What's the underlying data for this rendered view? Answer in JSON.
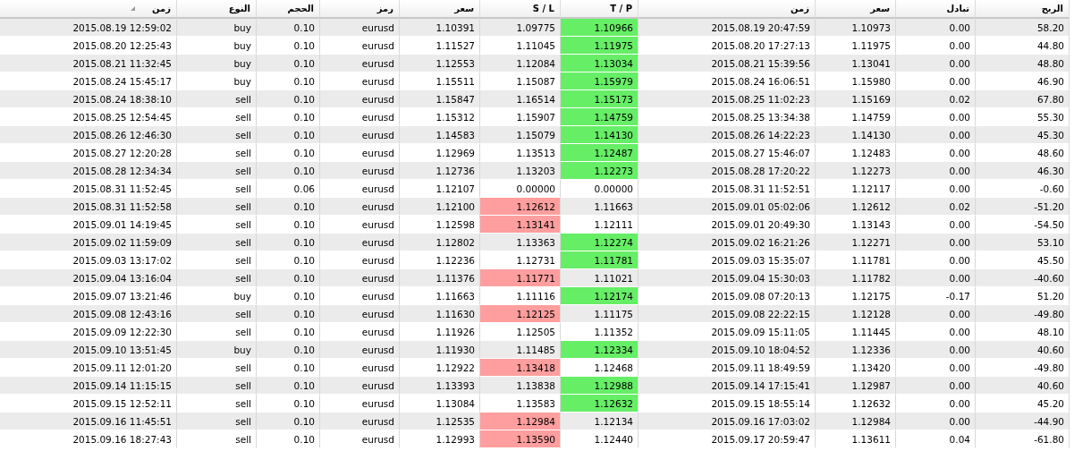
{
  "table": {
    "columns": [
      {
        "label": "زمن",
        "sorted": true
      },
      {
        "label": "النوع",
        "sorted": false
      },
      {
        "label": "الحجم",
        "sorted": false
      },
      {
        "label": "رمز",
        "sorted": false
      },
      {
        "label": "سعر",
        "sorted": false
      },
      {
        "label": "S / L",
        "sorted": false
      },
      {
        "label": "T / P",
        "sorted": false
      },
      {
        "label": "زمن",
        "sorted": false
      },
      {
        "label": "سعر",
        "sorted": false
      },
      {
        "label": "تبادل",
        "sorted": false
      },
      {
        "label": "الربح",
        "sorted": false
      }
    ],
    "rows": [
      {
        "cells": [
          "2015.08.19 12:59:02",
          "buy",
          "0.10",
          "eurusd",
          "1.10391",
          "1.09775",
          "1.10966",
          "2015.08.19 20:47:59",
          "1.10973",
          "0.00",
          "58.20"
        ],
        "sl_hit": false,
        "tp_hit": true
      },
      {
        "cells": [
          "2015.08.20 12:25:43",
          "buy",
          "0.10",
          "eurusd",
          "1.11527",
          "1.11045",
          "1.11975",
          "2015.08.20 17:27:13",
          "1.11975",
          "0.00",
          "44.80"
        ],
        "sl_hit": false,
        "tp_hit": true
      },
      {
        "cells": [
          "2015.08.21 11:32:45",
          "buy",
          "0.10",
          "eurusd",
          "1.12553",
          "1.12084",
          "1.13034",
          "2015.08.21 15:39:56",
          "1.13041",
          "0.00",
          "48.80"
        ],
        "sl_hit": false,
        "tp_hit": true
      },
      {
        "cells": [
          "2015.08.24 15:45:17",
          "buy",
          "0.10",
          "eurusd",
          "1.15511",
          "1.15087",
          "1.15979",
          "2015.08.24 16:06:51",
          "1.15980",
          "0.00",
          "46.90"
        ],
        "sl_hit": false,
        "tp_hit": true
      },
      {
        "cells": [
          "2015.08.24 18:38:10",
          "sell",
          "0.10",
          "eurusd",
          "1.15847",
          "1.16514",
          "1.15173",
          "2015.08.25 11:02:23",
          "1.15169",
          "0.02",
          "67.80"
        ],
        "sl_hit": false,
        "tp_hit": true
      },
      {
        "cells": [
          "2015.08.25 12:54:45",
          "sell",
          "0.10",
          "eurusd",
          "1.15312",
          "1.15907",
          "1.14759",
          "2015.08.25 13:34:38",
          "1.14759",
          "0.00",
          "55.30"
        ],
        "sl_hit": false,
        "tp_hit": true
      },
      {
        "cells": [
          "2015.08.26 12:46:30",
          "sell",
          "0.10",
          "eurusd",
          "1.14583",
          "1.15079",
          "1.14130",
          "2015.08.26 14:22:23",
          "1.14130",
          "0.00",
          "45.30"
        ],
        "sl_hit": false,
        "tp_hit": true
      },
      {
        "cells": [
          "2015.08.27 12:20:28",
          "sell",
          "0.10",
          "eurusd",
          "1.12969",
          "1.13513",
          "1.12487",
          "2015.08.27 15:46:07",
          "1.12483",
          "0.00",
          "48.60"
        ],
        "sl_hit": false,
        "tp_hit": true
      },
      {
        "cells": [
          "2015.08.28 12:34:34",
          "sell",
          "0.10",
          "eurusd",
          "1.12736",
          "1.13203",
          "1.12273",
          "2015.08.28 17:20:22",
          "1.12273",
          "0.00",
          "46.30"
        ],
        "sl_hit": false,
        "tp_hit": true
      },
      {
        "cells": [
          "2015.08.31 11:52:45",
          "sell",
          "0.06",
          "eurusd",
          "1.12107",
          "0.00000",
          "0.00000",
          "2015.08.31 11:52:51",
          "1.12117",
          "0.00",
          "-0.60"
        ],
        "sl_hit": false,
        "tp_hit": false
      },
      {
        "cells": [
          "2015.08.31 11:52:58",
          "sell",
          "0.10",
          "eurusd",
          "1.12100",
          "1.12612",
          "1.11663",
          "2015.09.01 05:02:06",
          "1.12612",
          "0.02",
          "-51.20"
        ],
        "sl_hit": true,
        "tp_hit": false
      },
      {
        "cells": [
          "2015.09.01 14:19:45",
          "sell",
          "0.10",
          "eurusd",
          "1.12598",
          "1.13141",
          "1.12111",
          "2015.09.01 20:49:30",
          "1.13143",
          "0.00",
          "-54.50"
        ],
        "sl_hit": true,
        "tp_hit": false
      },
      {
        "cells": [
          "2015.09.02 11:59:09",
          "sell",
          "0.10",
          "eurusd",
          "1.12802",
          "1.13363",
          "1.12274",
          "2015.09.02 16:21:26",
          "1.12271",
          "0.00",
          "53.10"
        ],
        "sl_hit": false,
        "tp_hit": true
      },
      {
        "cells": [
          "2015.09.03 13:17:02",
          "sell",
          "0.10",
          "eurusd",
          "1.12236",
          "1.12731",
          "1.11781",
          "2015.09.03 15:35:07",
          "1.11781",
          "0.00",
          "45.50"
        ],
        "sl_hit": false,
        "tp_hit": true
      },
      {
        "cells": [
          "2015.09.04 13:16:04",
          "sell",
          "0.10",
          "eurusd",
          "1.11376",
          "1.11771",
          "1.11021",
          "2015.09.04 15:30:03",
          "1.11782",
          "0.00",
          "-40.60"
        ],
        "sl_hit": true,
        "tp_hit": false
      },
      {
        "cells": [
          "2015.09.07 13:21:46",
          "buy",
          "0.10",
          "eurusd",
          "1.11663",
          "1.11116",
          "1.12174",
          "2015.09.08 07:20:13",
          "1.12175",
          "-0.17",
          "51.20"
        ],
        "sl_hit": false,
        "tp_hit": true
      },
      {
        "cells": [
          "2015.09.08 12:43:16",
          "sell",
          "0.10",
          "eurusd",
          "1.11630",
          "1.12125",
          "1.11175",
          "2015.09.08 22:22:15",
          "1.12128",
          "0.00",
          "-49.80"
        ],
        "sl_hit": true,
        "tp_hit": false
      },
      {
        "cells": [
          "2015.09.09 12:22:30",
          "sell",
          "0.10",
          "eurusd",
          "1.11926",
          "1.12505",
          "1.11352",
          "2015.09.09 15:11:05",
          "1.11445",
          "0.00",
          "48.10"
        ],
        "sl_hit": false,
        "tp_hit": false
      },
      {
        "cells": [
          "2015.09.10 13:51:45",
          "buy",
          "0.10",
          "eurusd",
          "1.11930",
          "1.11485",
          "1.12334",
          "2015.09.10 18:04:52",
          "1.12336",
          "0.00",
          "40.60"
        ],
        "sl_hit": false,
        "tp_hit": true
      },
      {
        "cells": [
          "2015.09.11 12:01:20",
          "sell",
          "0.10",
          "eurusd",
          "1.12922",
          "1.13418",
          "1.12468",
          "2015.09.11 18:49:59",
          "1.13420",
          "0.00",
          "-49.80"
        ],
        "sl_hit": true,
        "tp_hit": false
      },
      {
        "cells": [
          "2015.09.14 11:15:15",
          "sell",
          "0.10",
          "eurusd",
          "1.13393",
          "1.13838",
          "1.12988",
          "2015.09.14 17:15:41",
          "1.12987",
          "0.00",
          "40.60"
        ],
        "sl_hit": false,
        "tp_hit": true
      },
      {
        "cells": [
          "2015.09.15 12:52:11",
          "sell",
          "0.10",
          "eurusd",
          "1.13084",
          "1.13583",
          "1.12632",
          "2015.09.15 18:55:14",
          "1.12632",
          "0.00",
          "45.20"
        ],
        "sl_hit": false,
        "tp_hit": true
      },
      {
        "cells": [
          "2015.09.16 11:45:51",
          "sell",
          "0.10",
          "eurusd",
          "1.12535",
          "1.12984",
          "1.12134",
          "2015.09.16 17:03:02",
          "1.12984",
          "0.00",
          "-44.90"
        ],
        "sl_hit": true,
        "tp_hit": false
      },
      {
        "cells": [
          "2015.09.16 18:27:43",
          "sell",
          "0.10",
          "eurusd",
          "1.12993",
          "1.13590",
          "1.12440",
          "2015.09.17 20:59:47",
          "1.13611",
          "0.04",
          "-61.80"
        ],
        "sl_hit": true,
        "tp_hit": false
      }
    ]
  }
}
